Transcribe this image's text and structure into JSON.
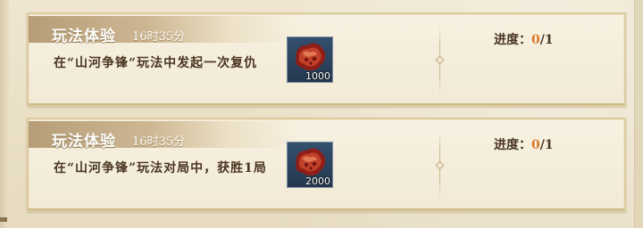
{
  "quests": [
    {
      "title": "玩法体验",
      "timer": "16时35分",
      "description": "在“山河争锋“玩法中发起一次复仇",
      "reward": {
        "icon": "red-gem-icon",
        "count": "1000"
      },
      "progress": {
        "label": "进度：",
        "current": "0",
        "separator": "/",
        "total": "1"
      }
    },
    {
      "title": "玩法体验",
      "timer": "16时35分",
      "description": "在“山河争锋”玩法对局中，获胜1局",
      "reward": {
        "icon": "red-gem-icon",
        "count": "2000"
      },
      "progress": {
        "label": "进度：",
        "current": "0",
        "separator": "/",
        "total": "1"
      }
    }
  ],
  "colors": {
    "progress_current": "#d77a2a",
    "text": "#4a3522",
    "title": "#ffffff"
  }
}
